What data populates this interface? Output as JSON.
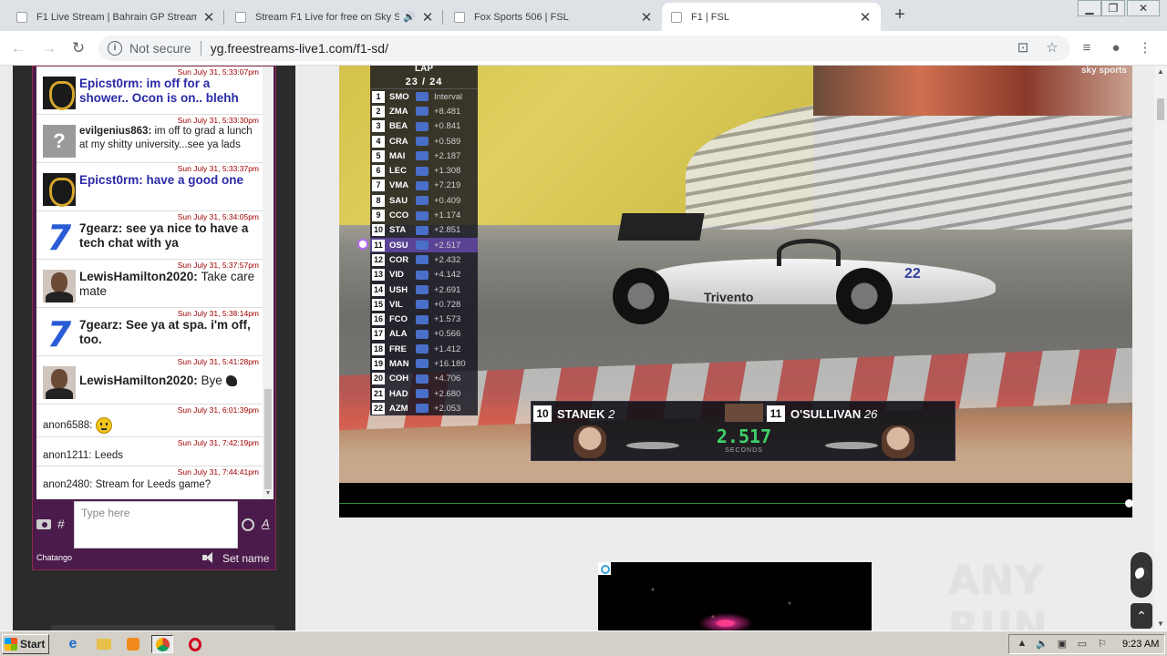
{
  "tabs": [
    {
      "title": "F1 Live Stream | Bahrain GP Stream",
      "active": false
    },
    {
      "title": "Stream F1 Live for free on Sky S",
      "active": false,
      "audio": true
    },
    {
      "title": "Fox Sports 506 | FSL",
      "active": false
    },
    {
      "title": "F1 | FSL",
      "active": true
    }
  ],
  "toolbar": {
    "security_label": "Not secure",
    "url": "yg.freestreams-live1.com/f1-sd/"
  },
  "chat": {
    "messages": [
      {
        "time": "Sun July 31, 5:33:07pm",
        "user": "Epicst0rm",
        "text": "im off for a shower.. Ocon is on.. blehh",
        "avatar": "lion",
        "style": "bold-purple"
      },
      {
        "time": "Sun July 31, 5:33:30pm",
        "user": "evilgenius863",
        "text": "im off to grad a lunch at my shitty university...see ya lads",
        "avatar": "question",
        "style": "small"
      },
      {
        "time": "Sun July 31, 5:33:37pm",
        "user": "Epicst0rm",
        "text": "have a good one",
        "avatar": "lion",
        "style": "bold-purple"
      },
      {
        "time": "Sun July 31, 5:34:05pm",
        "user": "7gearz",
        "text": "see ya nice to have a tech chat with ya",
        "avatar": "seven",
        "style": "bold"
      },
      {
        "time": "Sun July 31, 5:37:57pm",
        "user": "LewisHamilton2020",
        "text": "Take care mate",
        "avatar": "lewis",
        "style": "normal"
      },
      {
        "time": "Sun July 31, 5:38:14pm",
        "user": "7gearz",
        "text": "See ya at spa. i'm off, too.",
        "avatar": "seven",
        "style": "bold"
      },
      {
        "time": "Sun July 31, 5:41:28pm",
        "user": "LewisHamilton2020",
        "text": "Bye",
        "avatar": "lewis",
        "style": "normal",
        "trailing_icon": "clap-icon"
      },
      {
        "time": "Sun July 31, 6:01:39pm",
        "user": "anon6588",
        "text": "",
        "avatar": "none",
        "style": "small",
        "trailing_icon": "smiley-icon"
      },
      {
        "time": "Sun July 31, 7:42:19pm",
        "user": "anon1211",
        "text": "Leeds",
        "avatar": "none",
        "style": "small"
      },
      {
        "time": "Sun July 31, 7:44:41pm",
        "user": "anon2480",
        "text": "Stream for Leeds game?",
        "avatar": "none",
        "style": "small"
      }
    ],
    "input_placeholder": "Type here",
    "hash_label": "#",
    "font_label": "A",
    "brand": "Chatango",
    "set_name_label": "Set name"
  },
  "video": {
    "broadcaster": "sky sports",
    "tower_header": "LAP",
    "lap": "23 / 24",
    "leaderboard": [
      {
        "pos": "1",
        "code": "SMO",
        "gap": "Interval"
      },
      {
        "pos": "2",
        "code": "ZMA",
        "gap": "+8.481"
      },
      {
        "pos": "3",
        "code": "BEA",
        "gap": "+0.841"
      },
      {
        "pos": "4",
        "code": "CRA",
        "gap": "+0.589"
      },
      {
        "pos": "5",
        "code": "MAI",
        "gap": "+2.187"
      },
      {
        "pos": "6",
        "code": "LEC",
        "gap": "+1.308"
      },
      {
        "pos": "7",
        "code": "VMA",
        "gap": "+7.219"
      },
      {
        "pos": "8",
        "code": "SAU",
        "gap": "+0.409"
      },
      {
        "pos": "9",
        "code": "CCO",
        "gap": "+1.174"
      },
      {
        "pos": "10",
        "code": "STA",
        "gap": "+2.851"
      },
      {
        "pos": "11",
        "code": "OSU",
        "gap": "+2.517",
        "highlight": true
      },
      {
        "pos": "12",
        "code": "COR",
        "gap": "+2.432"
      },
      {
        "pos": "13",
        "code": "VID",
        "gap": "+4.142"
      },
      {
        "pos": "14",
        "code": "USH",
        "gap": "+2.691"
      },
      {
        "pos": "15",
        "code": "VIL",
        "gap": "+0.728"
      },
      {
        "pos": "16",
        "code": "FCO",
        "gap": "+1.573"
      },
      {
        "pos": "17",
        "code": "ALA",
        "gap": "+0.566"
      },
      {
        "pos": "18",
        "code": "FRE",
        "gap": "+1.412"
      },
      {
        "pos": "19",
        "code": "MAN",
        "gap": "+16.180"
      },
      {
        "pos": "20",
        "code": "COH",
        "gap": "+4.706"
      },
      {
        "pos": "21",
        "code": "HAD",
        "gap": "+2.680"
      },
      {
        "pos": "22",
        "code": "AZM",
        "gap": "+2.053"
      }
    ],
    "battle": {
      "left_pos": "10",
      "left_name": "STANEK",
      "left_num": "2",
      "right_pos": "11",
      "right_name": "O'SULLIVAN",
      "right_num": "26",
      "gap": "2.517",
      "gap_unit": "SECONDS"
    },
    "car_sponsor": "Trivento",
    "car_number": "22"
  },
  "watermark": "ANY RUN",
  "taskbar": {
    "start_label": "Start",
    "clock": "9:23 AM"
  },
  "colors": {
    "chat_bg": "#4b1b4b",
    "timestamp": "#a00000",
    "username_purple": "#2a2aa8",
    "battle_gap": "#3fd26a"
  }
}
